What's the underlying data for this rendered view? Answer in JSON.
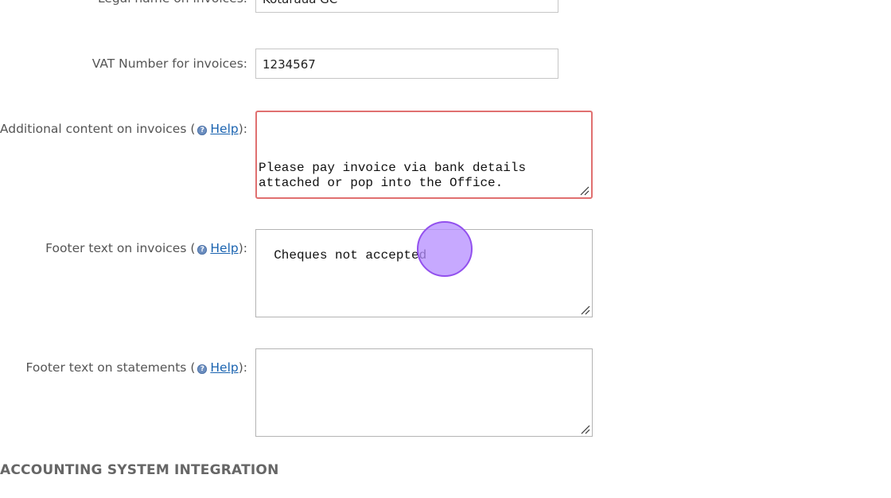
{
  "form": {
    "legal_name": {
      "label": "Legal name on invoices:",
      "value": "Kotaraua GC"
    },
    "vat_number": {
      "label": "VAT Number for invoices:",
      "value": "1234567"
    },
    "additional_content": {
      "label_prefix": "Additional content on invoices (",
      "help_text": "Help",
      "label_suffix": "):",
      "value": "\n\nPlease pay invoice via bank details\nattached or pop into the Office."
    },
    "footer_invoices": {
      "label_prefix": "Footer text on invoices (",
      "help_text": "Help",
      "label_suffix": "):",
      "value": "Cheques not accepted"
    },
    "footer_statements": {
      "label_prefix": "Footer text on statements (",
      "help_text": "Help",
      "label_suffix": "):",
      "value": ""
    }
  },
  "section": {
    "heading": "ACCOUNTING SYSTEM INTEGRATION"
  },
  "colors": {
    "error_border": "#e07070",
    "link": "#1a63b0",
    "cursor": "#9250ee"
  },
  "icons": {
    "help": "help-circle-icon",
    "resize": "resize-grip-icon"
  }
}
